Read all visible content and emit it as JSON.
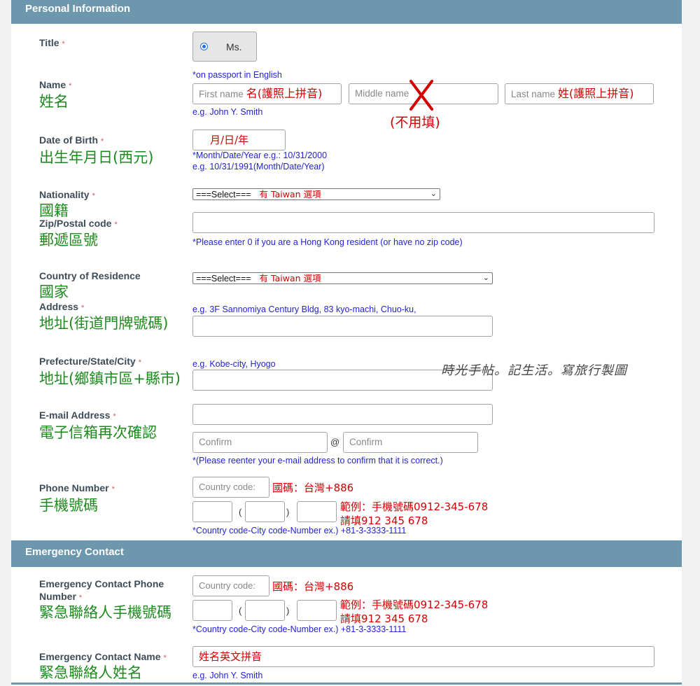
{
  "sections": {
    "personal": "Personal Information",
    "emergency": "Emergency Contact"
  },
  "title": {
    "label": "Title",
    "req": "*",
    "option": "Ms."
  },
  "name": {
    "label": "Name",
    "req": "*",
    "zh": "姓名",
    "hint_top": "*on passport in English",
    "first_placeholder": "First name",
    "first_note": "名(護照上拼音)",
    "middle_placeholder": "Middle name",
    "middle_note": "(不用填)",
    "last_placeholder": "Last name",
    "last_note": "姓(護照上拼音)",
    "example": "e.g. John Y. Smith"
  },
  "dob": {
    "label": "Date of Birth",
    "req": "*",
    "zh": "出生年月日(西元)",
    "value": "月/日/年",
    "hint1": "*Month/Date/Year   e.g.: 10/31/2000",
    "hint2": "e.g. 10/31/1991(Month/Date/Year)"
  },
  "nationality": {
    "label": "Nationality",
    "req": "*",
    "zh": "國籍",
    "select": "===Select===",
    "note": "有 Taiwan 選項"
  },
  "zip": {
    "label": "Zip/Postal code",
    "req": "*",
    "zh": "郵遞區號",
    "hint": "*Please enter 0 if you are a Hong Kong resident (or have no zip code)"
  },
  "residence": {
    "label": "Country of Residence",
    "zh": "國家",
    "select": "===Select===",
    "note": "有 Taiwan 選項"
  },
  "address": {
    "label": "Address",
    "req": "*",
    "zh": "地址(街道門牌號碼)",
    "hint": "e.g. 3F Sannomiya Century Bldg, 83 kyo-machi, Chuo-ku,"
  },
  "city": {
    "label": "Prefecture/State/City",
    "req": "*",
    "zh": "地址(鄉鎮市區+縣市)",
    "hint": "e.g. Kobe-city, Hyogo"
  },
  "watermark": "時光手帖。記生活。寫旅行製圖",
  "email": {
    "label": "E-mail Address",
    "req": "*",
    "zh": "電子信箱再次確認",
    "confirm1": "Confirm",
    "at": "@",
    "confirm2": "Confirm",
    "hint": "*(Please reenter your e-mail address to confirm that it is correct.)"
  },
  "phone": {
    "label": "Phone Number",
    "req": "*",
    "zh": "手機號碼",
    "country_placeholder": "Country code:",
    "country_note": "國碼：台灣+886",
    "open_paren": "(",
    "close_paren": ")",
    "note1": "範例：手機號碼0912-345-678",
    "note2": "請填912 345 678",
    "hint": "*Country code-City code-Number ex.) +81-3-3333-1111"
  },
  "ec_phone": {
    "label1": "Emergency Contact Phone",
    "label2": "Number",
    "req": "*",
    "zh": "緊急聯絡人手機號碼",
    "country_placeholder": "Country code:",
    "country_note": "國碼：台灣+886",
    "open_paren": "(",
    "close_paren": ")",
    "note1": "範例：手機號碼0912-345-678",
    "note2": "請填912 345 678",
    "hint": "*Country code-City code-Number ex.) +81-3-3333-1111"
  },
  "ec_name": {
    "label": "Emergency Contact Name",
    "req": "*",
    "zh": "緊急聯絡人姓名",
    "value": "姓名英文拼音",
    "example": "e.g. John Y. Smith"
  }
}
